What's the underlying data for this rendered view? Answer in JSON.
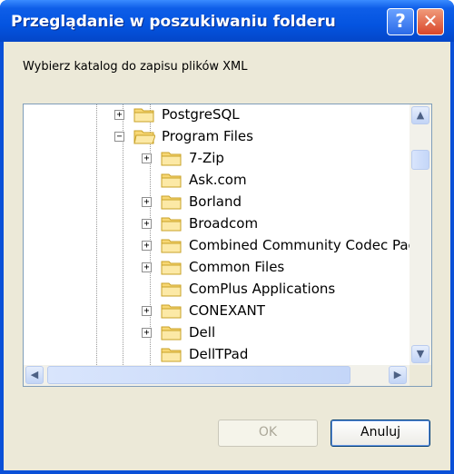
{
  "window": {
    "title": "Przeglądanie w poszukiwaniu folderu",
    "help_button": "?",
    "close_button": "✕"
  },
  "description": "Wybierz katalog do zapisu plików XML",
  "tree": {
    "items": [
      {
        "label": "PostgreSQL",
        "expander": "+",
        "level": 1
      },
      {
        "label": "Program Files",
        "expander": "−",
        "level": 1
      },
      {
        "label": "7-Zip",
        "expander": "+",
        "level": 2
      },
      {
        "label": "Ask.com",
        "expander": "",
        "level": 2
      },
      {
        "label": "Borland",
        "expander": "+",
        "level": 2
      },
      {
        "label": "Broadcom",
        "expander": "+",
        "level": 2
      },
      {
        "label": "Combined Community Codec Pac",
        "expander": "+",
        "level": 2
      },
      {
        "label": "Common Files",
        "expander": "+",
        "level": 2
      },
      {
        "label": "ComPlus Applications",
        "expander": "",
        "level": 2
      },
      {
        "label": "CONEXANT",
        "expander": "+",
        "level": 2
      },
      {
        "label": "Dell",
        "expander": "+",
        "level": 2
      },
      {
        "label": "DellTPad",
        "expander": "",
        "level": 2
      }
    ]
  },
  "scrollbars": {
    "up_arrow": "▲",
    "down_arrow": "▼",
    "left_arrow": "◀",
    "right_arrow": "▶"
  },
  "buttons": {
    "ok_label": "OK",
    "cancel_label": "Anuluj"
  }
}
